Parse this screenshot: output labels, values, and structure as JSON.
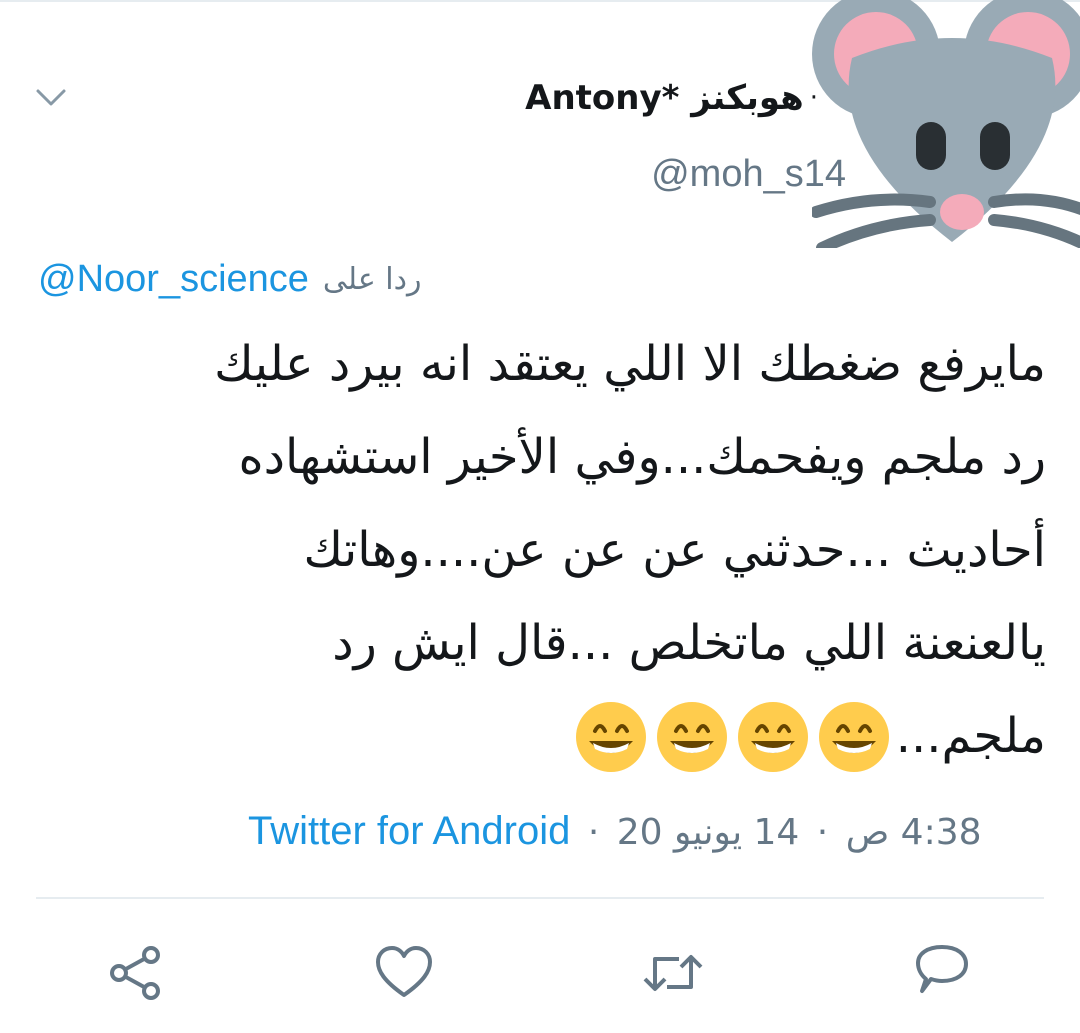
{
  "tweet": {
    "display_name": "هوبكنز *Antony",
    "name_separator": "·",
    "handle": "@moh_s14",
    "replying_to_label": "ردا على",
    "replying_to_handle": "@Noor_science",
    "body_lines": [
      "مايرفع ضغطك الا اللي يعتقد انه بيرد عليك",
      "رد ملجم ويفحمك...وفي الأخير استشهاده",
      "أحاديث ...حدثني عن عن عن....وهاتك",
      "يالعنعنة اللي ماتخلص ...قال ايش رد",
      "ملجم..."
    ],
    "emojis": [
      "grinning-face-with-smiling-eyes",
      "grinning-face-with-smiling-eyes",
      "grinning-face-with-smiling-eyes",
      "grinning-face-with-smiling-eyes"
    ],
    "time": "4:38 ص",
    "date": "14 يونيو 20",
    "meta_separator": "·",
    "source": "Twitter for Android"
  },
  "avatar": {
    "icon": "mouse-face-icon"
  },
  "actions": [
    {
      "name": "share",
      "icon": "share-icon"
    },
    {
      "name": "like",
      "icon": "heart-icon"
    },
    {
      "name": "retweet",
      "icon": "retweet-icon"
    },
    {
      "name": "reply",
      "icon": "reply-icon"
    }
  ],
  "colors": {
    "link": "#1b95e0",
    "secondary_text": "#657786",
    "primary_text": "#14171a",
    "divider": "#e6ecf0",
    "icon": "#657786"
  }
}
